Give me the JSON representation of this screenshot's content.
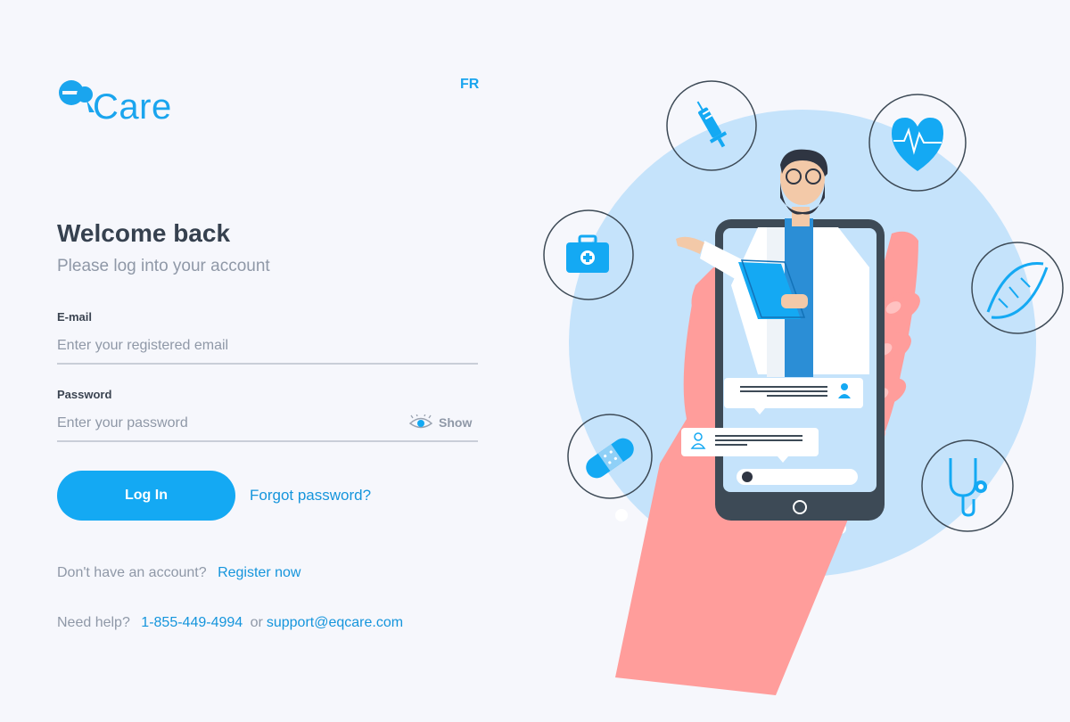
{
  "brand": {
    "name": "Care"
  },
  "lang_toggle": "FR",
  "heading": {
    "title": "Welcome back",
    "subtitle": "Please log into your account"
  },
  "form": {
    "email_label": "E-mail",
    "email_placeholder": "Enter your registered email",
    "email_value": "",
    "password_label": "Password",
    "password_placeholder": "Enter your password",
    "password_value": "",
    "show_label": "Show",
    "login_label": "Log In",
    "forgot_label": "Forgot password?"
  },
  "register": {
    "prompt": "Don't have an account?",
    "link": "Register now"
  },
  "help": {
    "prompt": "Need help?",
    "phone": "1-855-449-4994",
    "or": "or",
    "email": "support@eqcare.com"
  },
  "colors": {
    "accent": "#14a9f3",
    "link": "#1595dc",
    "background": "#f6f7fc",
    "muted_text": "#8f98a7",
    "heading_text": "#36414f"
  },
  "icons": [
    "eye-icon",
    "syringe-icon",
    "heart-pulse-icon",
    "medical-kit-icon",
    "dna-icon",
    "bandage-icon",
    "stethoscope-icon",
    "user-icon"
  ]
}
